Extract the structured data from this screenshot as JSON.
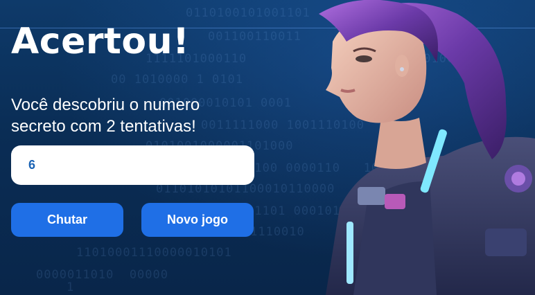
{
  "screen": {
    "title": "Acertou!",
    "message_line_1": "Você descobriu o numero",
    "message_line_2": "secreto com 2 tentativas!",
    "guess_value": "6"
  },
  "buttons": {
    "guess_label": "Chutar",
    "new_game_label": "Novo jogo"
  },
  "background": {
    "binary_rows": [
      "0110100101001101",
      "001100110011",
      "1111101000110",
      "0010001001",
      "00 1010000 1 0101",
      "001000010101 0001",
      "0011111000 1001110100",
      "0101001000001101000",
      "000000100 0000110   1000",
      "01101010101100010110000",
      "0110001101 0001011",
      "0000110001110010",
      "11010001110000010101",
      "0000011010  00000",
      "1"
    ]
  },
  "colors": {
    "background_top": "#0e3a6a",
    "background_bottom": "#09264a",
    "button": "#1f6fe6",
    "input_text": "#1b63b4",
    "text": "#ffffff"
  },
  "icons": {
    "illustration": "heroine-illustration"
  }
}
